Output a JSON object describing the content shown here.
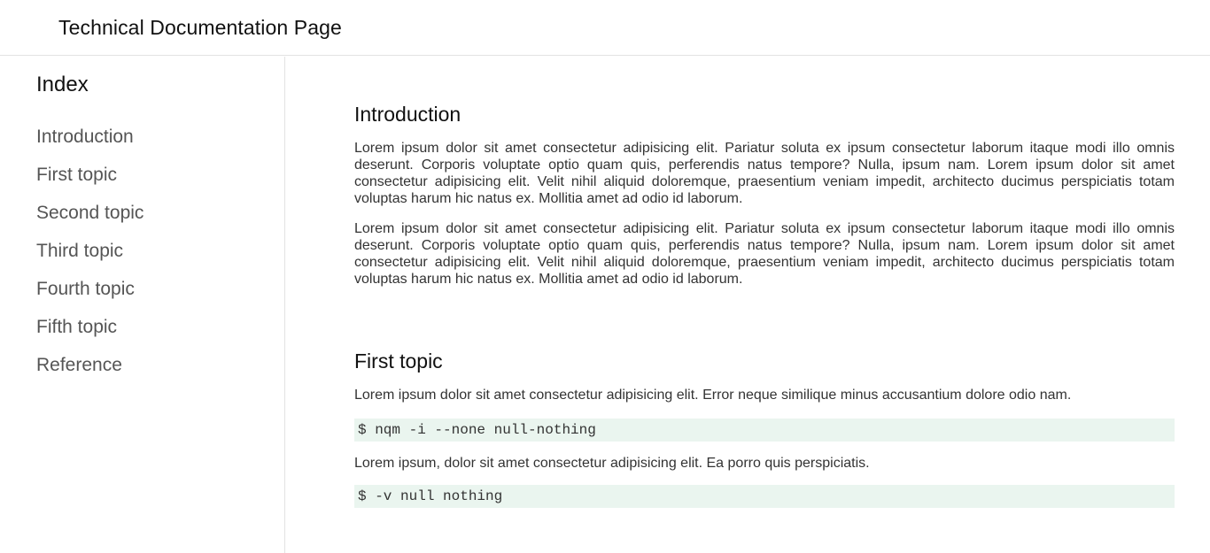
{
  "header": {
    "title": "Technical Documentation Page"
  },
  "sidebar": {
    "heading": "Index",
    "items": [
      {
        "label": "Introduction"
      },
      {
        "label": "First topic"
      },
      {
        "label": "Second topic"
      },
      {
        "label": "Third topic"
      },
      {
        "label": "Fourth topic"
      },
      {
        "label": "Fifth topic"
      },
      {
        "label": "Reference"
      }
    ]
  },
  "main": {
    "introduction": {
      "title": "Introduction",
      "paragraphs": [
        "Lorem ipsum dolor sit amet consectetur adipisicing elit. Pariatur soluta ex ipsum consectetur laborum itaque modi illo omnis deserunt. Corporis voluptate optio quam quis, perferendis natus tempore? Nulla, ipsum nam. Lorem ipsum dolor sit amet consectetur adipisicing elit. Velit nihil aliquid doloremque, praesentium veniam impedit, architecto ducimus perspiciatis totam voluptas harum hic natus ex. Mollitia amet ad odio id laborum.",
        "Lorem ipsum dolor sit amet consectetur adipisicing elit. Pariatur soluta ex ipsum consectetur laborum itaque modi illo omnis deserunt. Corporis voluptate optio quam quis, perferendis natus tempore? Nulla, ipsum nam. Lorem ipsum dolor sit amet consectetur adipisicing elit. Velit nihil aliquid doloremque, praesentium veniam impedit, architecto ducimus perspiciatis totam voluptas harum hic natus ex. Mollitia amet ad odio id laborum."
      ]
    },
    "first_topic": {
      "title": "First topic",
      "paragraph_1": "Lorem ipsum dolor sit amet consectetur adipisicing elit. Error neque similique minus accusantium dolore odio nam.",
      "code_1": "$ nqm -i --none null-nothing",
      "paragraph_2": "Lorem ipsum, dolor sit amet consectetur adipisicing elit. Ea porro quis perspiciatis.",
      "code_2": "$ -v null nothing"
    }
  },
  "colors": {
    "code_background": "#eaf5ef",
    "border": "#e3e3e3"
  }
}
